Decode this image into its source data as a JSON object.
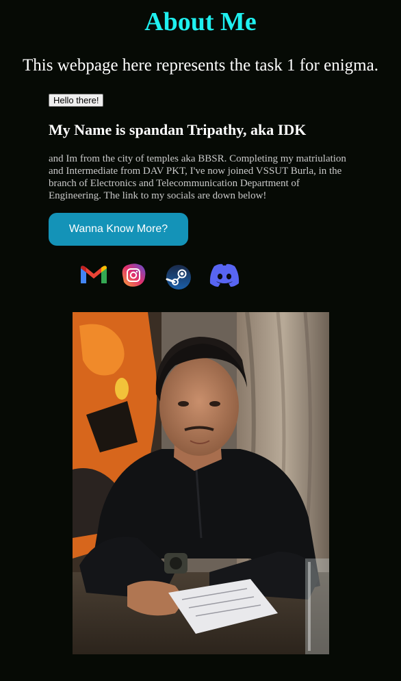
{
  "page": {
    "title": "About Me",
    "subtitle": "This webpage here represents the task 1 for enigma."
  },
  "hello_button": {
    "label": "Hello there!"
  },
  "profile": {
    "heading": "My Name is spandan Tripathy, aka IDK",
    "bio": "and Im from the city of temples aka BBSR. Completing my matriulation and Intermediate from DAV PKT, I've now joined VSSUT Burla, in the branch of Electronics and Telecommunication Department of Engineering. The link to my socials are down below!"
  },
  "more_button": {
    "label": "Wanna Know More?"
  },
  "socials": [
    {
      "name": "gmail",
      "icon": "gmail-icon"
    },
    {
      "name": "instagram",
      "icon": "instagram-icon"
    },
    {
      "name": "steam",
      "icon": "steam-icon"
    },
    {
      "name": "discord",
      "icon": "discord-icon"
    }
  ],
  "colors": {
    "background": "#060a05",
    "title": "#1ff0f0",
    "button_accent": "#1493b8",
    "bio_text": "#c9c9c9"
  }
}
